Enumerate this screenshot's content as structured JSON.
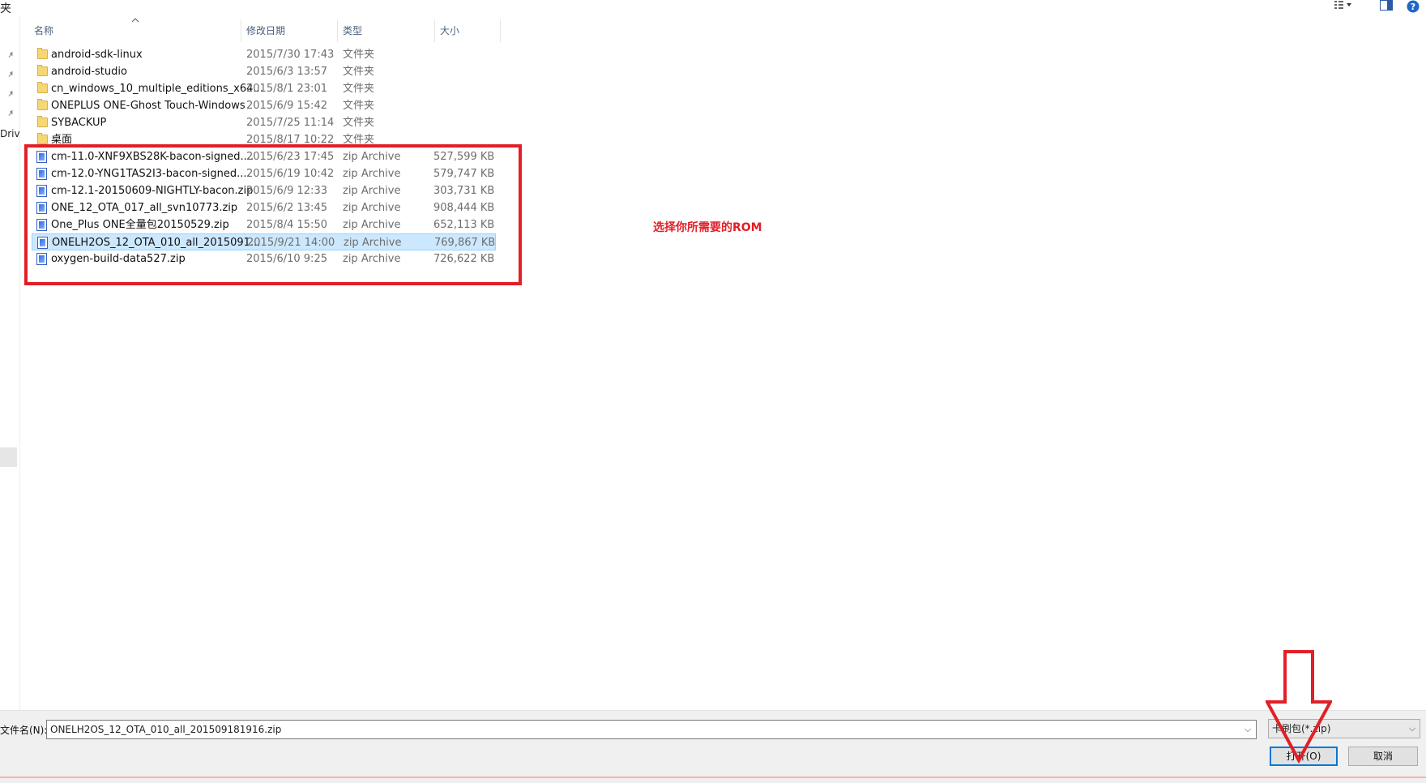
{
  "window": {
    "title_fragment": "夹"
  },
  "left_nav": {
    "drive_fragment": "Driv"
  },
  "columns": {
    "name": "名称",
    "date": "修改日期",
    "type": "类型",
    "size": "大小"
  },
  "files": [
    {
      "name": "android-sdk-linux",
      "date": "2015/7/30 17:43",
      "type": "文件夹",
      "size": "",
      "icon": "folder-icon"
    },
    {
      "name": "android-studio",
      "date": "2015/6/3 13:57",
      "type": "文件夹",
      "size": "",
      "icon": "folder-icon"
    },
    {
      "name": "cn_windows_10_multiple_editions_x64...",
      "date": "2015/8/1 23:01",
      "type": "文件夹",
      "size": "",
      "icon": "folder-icon"
    },
    {
      "name": "ONEPLUS ONE-Ghost Touch-Windows",
      "date": "2015/6/9 15:42",
      "type": "文件夹",
      "size": "",
      "icon": "folder-icon"
    },
    {
      "name": "SYBACKUP",
      "date": "2015/7/25 11:14",
      "type": "文件夹",
      "size": "",
      "icon": "folder-icon"
    },
    {
      "name": "桌面",
      "date": "2015/8/17 10:22",
      "type": "文件夹",
      "size": "",
      "icon": "folder-icon"
    },
    {
      "name": "cm-11.0-XNF9XBS28K-bacon-signed....",
      "date": "2015/6/23 17:45",
      "type": "zip Archive",
      "size": "527,599 KB",
      "icon": "zip-archive-icon"
    },
    {
      "name": "cm-12.0-YNG1TAS2I3-bacon-signed....",
      "date": "2015/6/19 10:42",
      "type": "zip Archive",
      "size": "579,747 KB",
      "icon": "zip-archive-icon"
    },
    {
      "name": "cm-12.1-20150609-NIGHTLY-bacon.zip",
      "date": "2015/6/9 12:33",
      "type": "zip Archive",
      "size": "303,731 KB",
      "icon": "zip-archive-icon"
    },
    {
      "name": "ONE_12_OTA_017_all_svn10773.zip",
      "date": "2015/6/2 13:45",
      "type": "zip Archive",
      "size": "908,444 KB",
      "icon": "zip-archive-icon"
    },
    {
      "name": "One_Plus ONE全量包20150529.zip",
      "date": "2015/8/4 15:50",
      "type": "zip Archive",
      "size": "652,113 KB",
      "icon": "zip-archive-icon"
    },
    {
      "name": "ONELH2OS_12_OTA_010_all_2015091...",
      "date": "2015/9/21 14:00",
      "type": "zip Archive",
      "size": "769,867 KB",
      "icon": "zip-archive-icon",
      "selected": true
    },
    {
      "name": "oxygen-build-data527.zip",
      "date": "2015/6/10 9:25",
      "type": "zip Archive",
      "size": "726,622 KB",
      "icon": "zip-archive-icon"
    }
  ],
  "annotation": {
    "note": "选择你所需要的ROM",
    "color": "#e21f27"
  },
  "footer": {
    "filename_label": "文件名(N):",
    "filename_value": "ONELH2OS_12_OTA_010_all_201509181916.zip",
    "filter_value": "卡刷包(*.zip)",
    "open_label": "打开(O)",
    "cancel_label": "取消"
  },
  "colors": {
    "selection_bg": "#cce8ff",
    "selection_border": "#99d1ff",
    "open_button_border": "#0078d7"
  }
}
